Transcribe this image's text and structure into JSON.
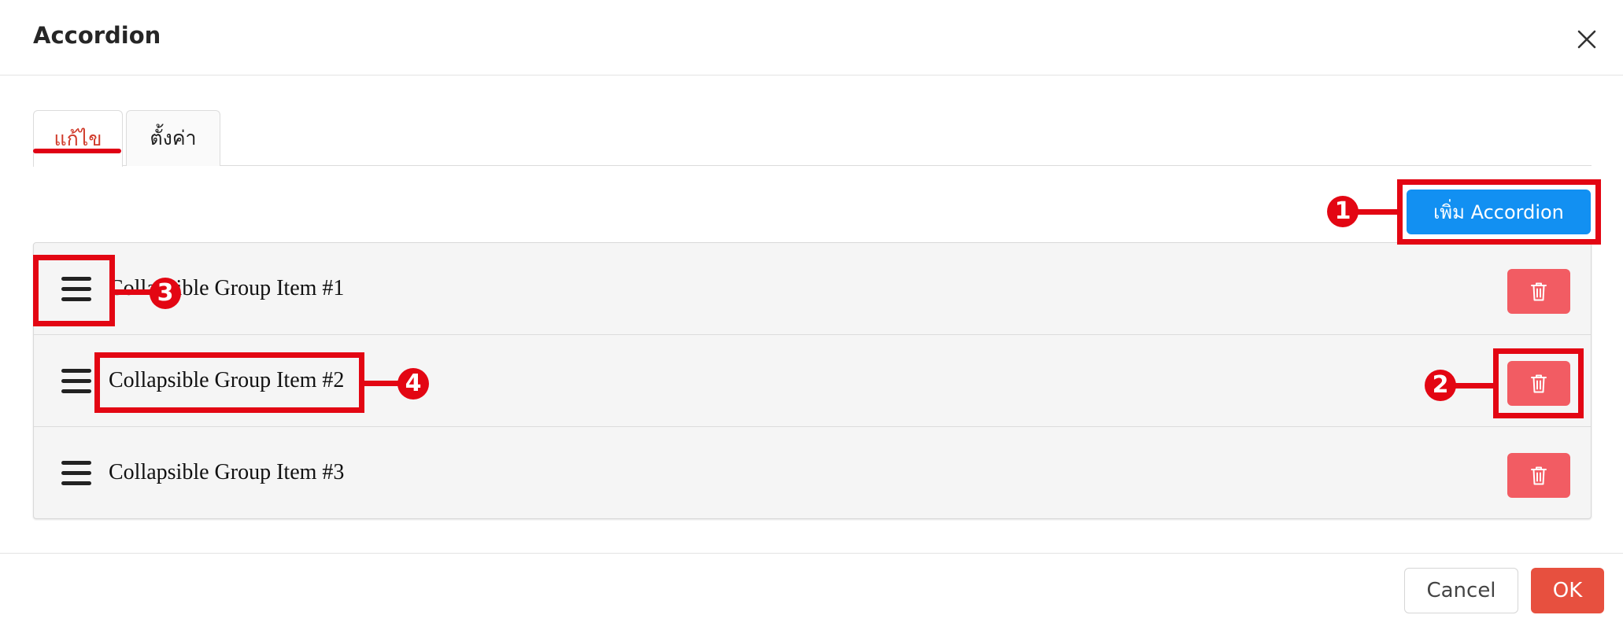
{
  "dialog": {
    "title": "Accordion"
  },
  "tabs": [
    {
      "label": "แก้ไข",
      "active": true
    },
    {
      "label": "ตั้งค่า",
      "active": false
    }
  ],
  "toolbar": {
    "add_label": "เพิ่ม Accordion"
  },
  "items": [
    {
      "label": "Collapsible Group Item #1"
    },
    {
      "label": "Collapsible Group Item #2"
    },
    {
      "label": "Collapsible Group Item #3"
    }
  ],
  "footer": {
    "cancel_label": "Cancel",
    "ok_label": "OK"
  },
  "annotations": [
    "1",
    "2",
    "3",
    "4"
  ],
  "icons": {
    "close": "close-icon",
    "drag": "drag-handle-icon",
    "delete": "trash-icon"
  },
  "colors": {
    "primary": "#1290f2",
    "danger": "#f25c63",
    "ok": "#e7503f",
    "active_tab": "#d03a2a",
    "annotation": "#e30613"
  }
}
